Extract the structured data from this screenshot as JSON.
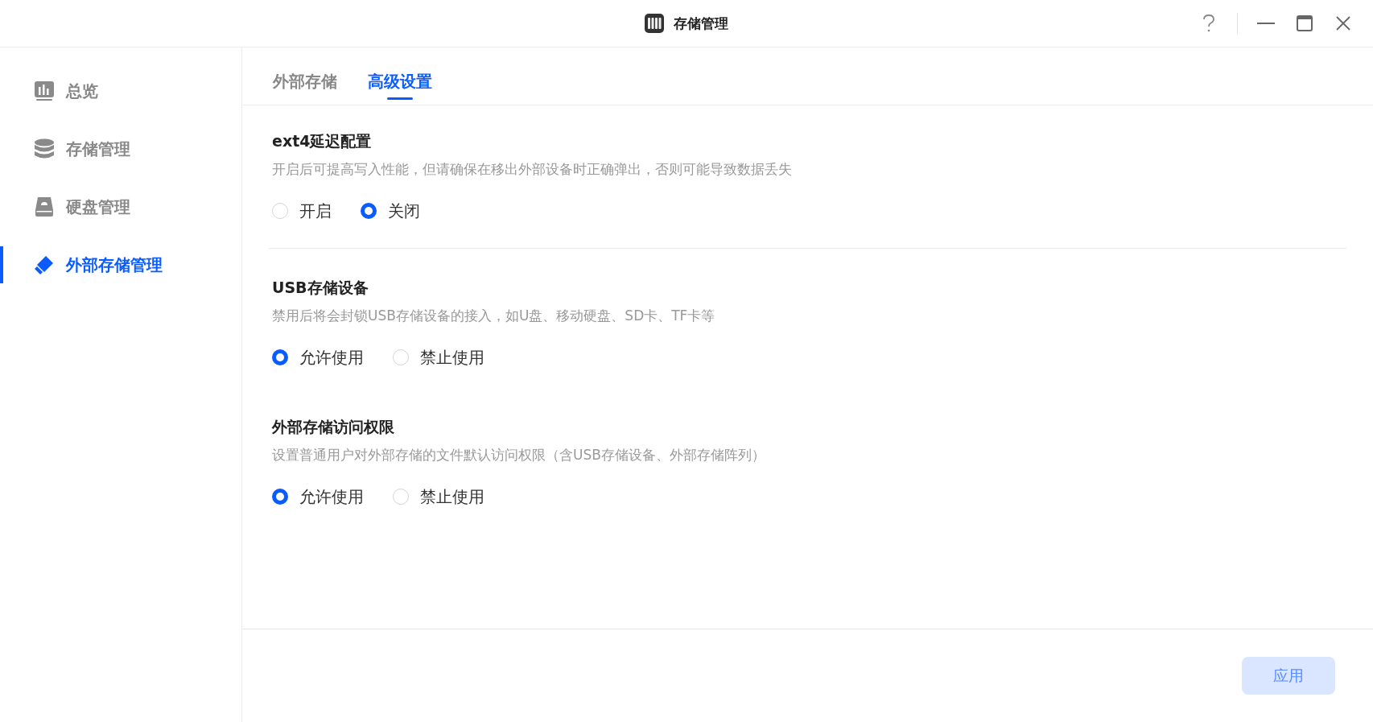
{
  "window": {
    "title": "存储管理"
  },
  "sidebar": {
    "items": [
      {
        "label": "总览",
        "selected": false
      },
      {
        "label": "存储管理",
        "selected": false
      },
      {
        "label": "硬盘管理",
        "selected": false
      },
      {
        "label": "外部存储管理",
        "selected": true
      }
    ]
  },
  "tabs": [
    {
      "label": "外部存储",
      "selected": false
    },
    {
      "label": "高级设置",
      "selected": true
    }
  ],
  "sections": [
    {
      "title": "ext4延迟配置",
      "description": "开启后可提高写入性能，但请确保在移出外部设备时正确弹出，否则可能导致数据丢失",
      "divider": true,
      "options": [
        {
          "label": "开启",
          "selected": false
        },
        {
          "label": "关闭",
          "selected": true
        }
      ]
    },
    {
      "title": "USB存储设备",
      "description": "禁用后将会封锁USB存储设备的接入，如U盘、移动硬盘、SD卡、TF卡等",
      "divider": false,
      "options": [
        {
          "label": "允许使用",
          "selected": true
        },
        {
          "label": "禁止使用",
          "selected": false
        }
      ]
    },
    {
      "title": "外部存储访问权限",
      "description": "设置普通用户对外部存储的文件默认访问权限（含USB存储设备、外部存储阵列）",
      "divider": false,
      "options": [
        {
          "label": "允许使用",
          "selected": true
        },
        {
          "label": "禁止使用",
          "selected": false
        }
      ]
    }
  ],
  "apply_button": {
    "label": "应用",
    "disabled": true
  }
}
